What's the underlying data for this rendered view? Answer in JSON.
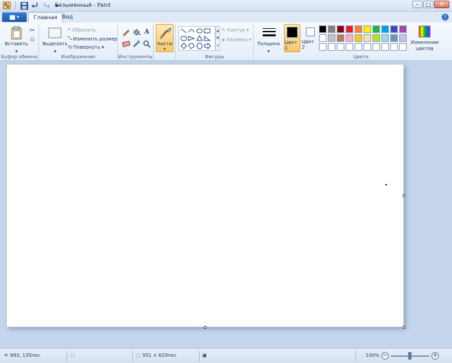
{
  "window": {
    "title": "Безымянный - Paint",
    "quick_access": [
      "save-icon",
      "undo-icon",
      "redo-icon",
      "customize-icon"
    ],
    "buttons": {
      "minimize": "–",
      "maximize": "□",
      "close": "✕"
    }
  },
  "tabs": [
    {
      "label": "Главная",
      "active": true
    },
    {
      "label": "Вид",
      "active": false
    }
  ],
  "help_label": "?",
  "ribbon": {
    "clipboard": {
      "label": "Буфер обмена",
      "paste": "Вставить"
    },
    "image": {
      "label": "Изображение",
      "select": "Выделить",
      "crop": "Обрезать",
      "resize": "Изменить размер",
      "rotate": "Повернуть"
    },
    "tools": {
      "label": "Инструменты",
      "text_glyph": "A"
    },
    "brushes": {
      "label": "Кисти"
    },
    "shapes": {
      "label": "Фигуры",
      "outline": "Контур",
      "fill": "Заливка"
    },
    "size": {
      "label": "Толщина"
    },
    "colors": {
      "label": "Цвета",
      "color1": "Цвет 1",
      "color2": "Цвет 2",
      "edit": "Изменение цветов",
      "color1_value": "#000000",
      "color2_value": "#ffffff",
      "palette": [
        "#000000",
        "#7f7f7f",
        "#880015",
        "#ed1c24",
        "#ff7f27",
        "#fff200",
        "#22b14c",
        "#00a2e8",
        "#3f48cc",
        "#a349a4",
        "#ffffff",
        "#c3c3c3",
        "#b97a57",
        "#ffaec9",
        "#ffc90e",
        "#efe4b0",
        "#b5e61d",
        "#99d9ea",
        "#7092be",
        "#c8bfe7",
        "#ffffff",
        "#ffffff",
        "#ffffff",
        "#ffffff",
        "#ffffff",
        "#ffffff",
        "#ffffff",
        "#ffffff",
        "#ffffff",
        "#ffffff"
      ]
    }
  },
  "status": {
    "cursor_pos": "893, 135пкс",
    "image_size": "951 × 629пкс",
    "zoom": "100%",
    "zoom_minus": "−",
    "zoom_plus": "+"
  }
}
